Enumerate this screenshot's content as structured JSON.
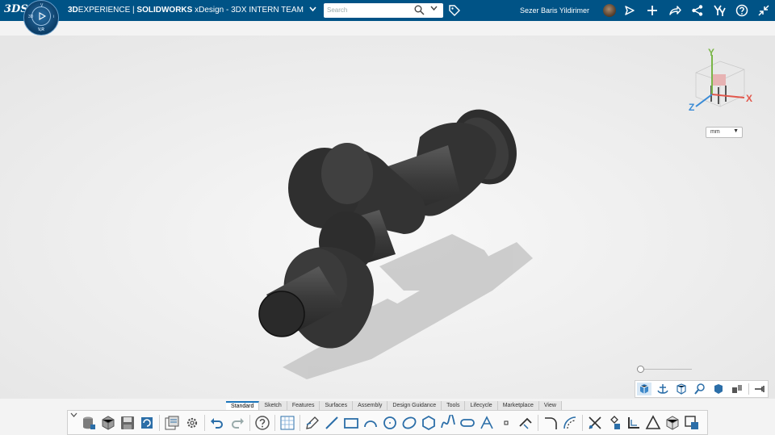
{
  "header": {
    "ds_logo": "3DS",
    "brand_bold": "3D",
    "brand_text": "EXPERIENCE | ",
    "brand_product": "SOLIDWORKS",
    "brand_rest": " xDesign - 3DX INTERN TEAM",
    "search_placeholder": "Search",
    "user_name": "Sezer Baris Yildirimer",
    "compass": {
      "top": "V",
      "left": "3D",
      "right": "i",
      "bottom": "V,R"
    }
  },
  "viewport": {
    "units_value": "mm",
    "axis_labels": {
      "x": "X",
      "y": "Y",
      "z": "Z"
    },
    "zoom_level": 0.0
  },
  "tabs": [
    "Standard",
    "Sketch",
    "Features",
    "Surfaces",
    "Assembly",
    "Design Guidance",
    "Tools",
    "Lifecycle",
    "Marketplace",
    "View"
  ],
  "active_tab": "Standard",
  "colors": {
    "header": "#005386",
    "accent": "#1b75bb",
    "part": "#3a3a3a",
    "background": "#f3f3f3"
  }
}
